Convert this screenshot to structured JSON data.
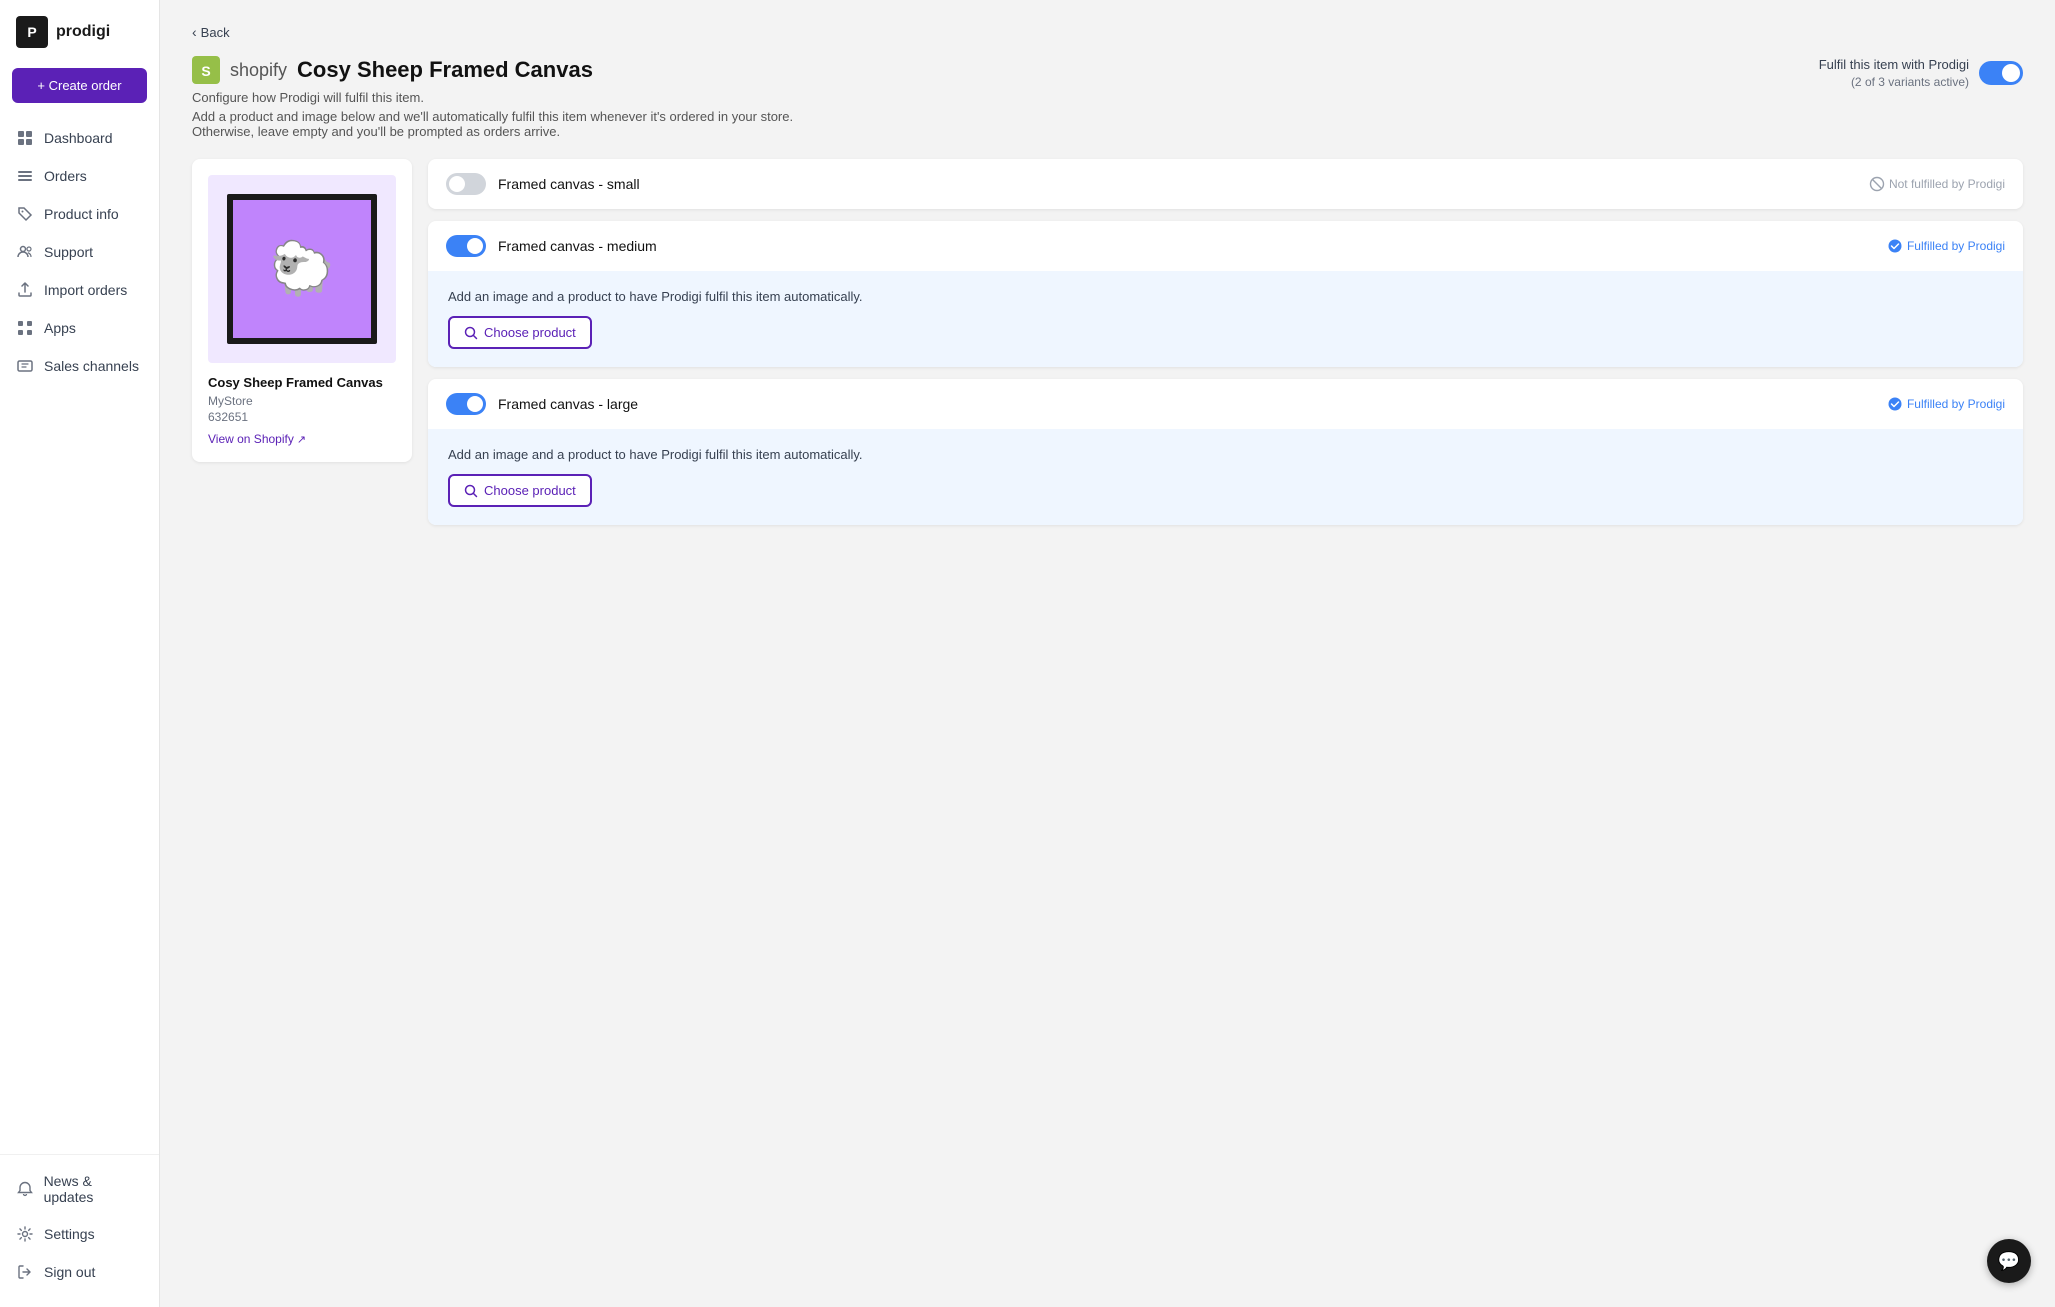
{
  "sidebar": {
    "logo": {
      "icon_text": "P",
      "name": "prodigi"
    },
    "create_order_label": "+ Create order",
    "nav_items": [
      {
        "id": "dashboard",
        "label": "Dashboard",
        "icon": "grid"
      },
      {
        "id": "orders",
        "label": "Orders",
        "icon": "list"
      },
      {
        "id": "product-info",
        "label": "Product info",
        "icon": "tag"
      },
      {
        "id": "support",
        "label": "Support",
        "icon": "people"
      },
      {
        "id": "import-orders",
        "label": "Import orders",
        "icon": "upload"
      },
      {
        "id": "apps",
        "label": "Apps",
        "icon": "apps"
      },
      {
        "id": "sales-channels",
        "label": "Sales channels",
        "icon": "channel"
      }
    ],
    "bottom_items": [
      {
        "id": "news-updates",
        "label": "News & updates",
        "icon": "bell"
      },
      {
        "id": "settings",
        "label": "Settings",
        "icon": "gear"
      },
      {
        "id": "sign-out",
        "label": "Sign out",
        "icon": "signout"
      }
    ]
  },
  "page": {
    "back_label": "Back",
    "shopify_icon": "🛍",
    "title": "Cosy Sheep Framed Canvas",
    "subtitle": "Configure how Prodigi will fulfil this item.",
    "description_line1": "Add a product and image below and we'll automatically fulfil this item whenever it's ordered in your store.",
    "description_line2": "Otherwise, leave empty and you'll be prompted as orders arrive.",
    "fulfil_label": "Fulfil this item with Prodigi",
    "fulfil_subtitle": "(2 of 3 variants active)",
    "fulfil_enabled": true
  },
  "product": {
    "name": "Cosy Sheep Framed Canvas",
    "store": "MyStore",
    "id": "632651",
    "view_link_label": "View on Shopify",
    "emoji": "🐑"
  },
  "variants": [
    {
      "id": "small",
      "name": "Framed canvas - small",
      "enabled": false,
      "status": "not_fulfilled",
      "status_label": "Not fulfilled by Prodigi",
      "has_body": false
    },
    {
      "id": "medium",
      "name": "Framed canvas - medium",
      "enabled": true,
      "status": "fulfilled",
      "status_label": "Fulfilled by Prodigi",
      "has_body": true,
      "body_text": "Add an image and a product to have Prodigi fulfil this item automatically.",
      "choose_product_label": "Choose product"
    },
    {
      "id": "large",
      "name": "Framed canvas - large",
      "enabled": true,
      "status": "fulfilled",
      "status_label": "Fulfilled by Prodigi",
      "has_body": true,
      "body_text": "Add an image and a product to have Prodigi fulfil this item automatically.",
      "choose_product_label": "Choose product"
    }
  ],
  "chat": {
    "icon": "💬"
  }
}
